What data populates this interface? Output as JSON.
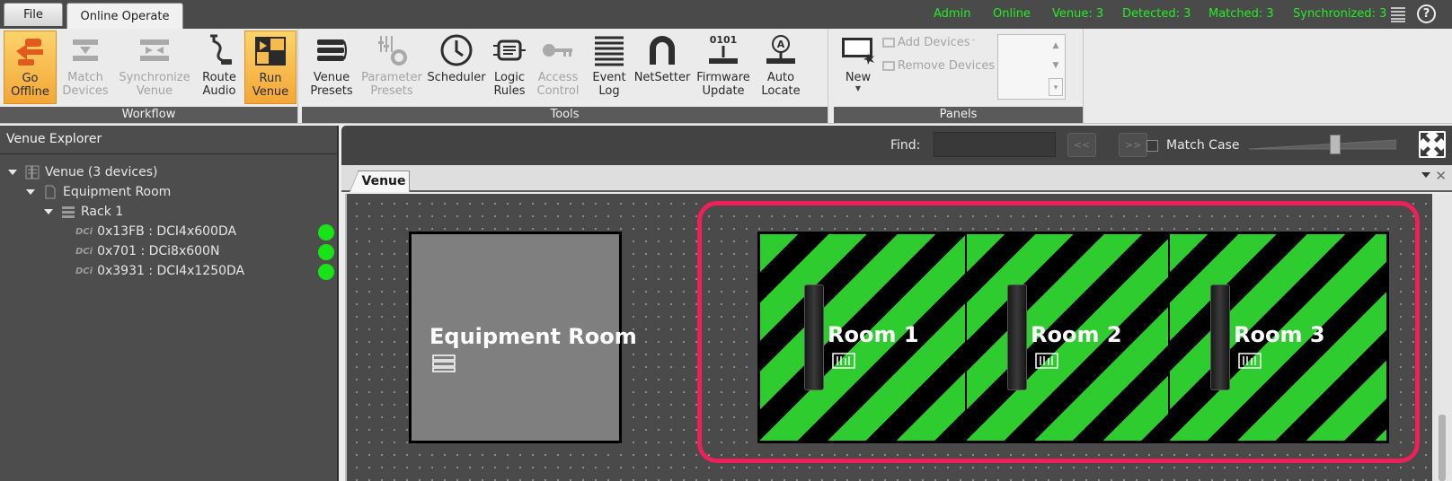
{
  "tabs": {
    "file": "File",
    "online_operate": "Online Operate"
  },
  "status": {
    "user": "Admin",
    "connection": "Online",
    "venue": "Venue: 3",
    "detected": "Detected: 3",
    "matched": "Matched: 3",
    "synchronized": "Synchronized: 3"
  },
  "ribbon": {
    "workflow": {
      "caption": "Workflow",
      "go_offline": "Go\nOffline",
      "match_devices": "Match\nDevices",
      "synchronize_venue": "Synchronize\nVenue",
      "route_audio": "Route\nAudio",
      "run_venue": "Run\nVenue"
    },
    "tools": {
      "caption": "Tools",
      "venue_presets": "Venue\nPresets",
      "parameter_presets": "Parameter\nPresets",
      "scheduler": "Scheduler",
      "logic_rules": "Logic\nRules",
      "access_control": "Access\nControl",
      "event_log": "Event\nLog",
      "netsetter": "NetSetter",
      "firmware_update": "Firmware\nUpdate",
      "auto_locate": "Auto\nLocate"
    },
    "panels": {
      "caption": "Panels",
      "new": "New",
      "add_devices": "Add Devices",
      "remove_devices": "Remove Devices"
    }
  },
  "explorer": {
    "title": "Venue Explorer",
    "venue": "Venue (3 devices)",
    "equipment_room": "Equipment Room",
    "rack": "Rack 1",
    "dci_tag": "DCi",
    "devices": [
      {
        "label": "0x13FB : DCI4x600DA",
        "status_color": "#17e317"
      },
      {
        "label": "0x701 : DCi8x600N",
        "status_color": "#17e317"
      },
      {
        "label": "0x3931 : DCI4x1250DA",
        "status_color": "#17e317"
      }
    ]
  },
  "find": {
    "label": "Find:",
    "value": "",
    "prev": "<<",
    "next": ">>",
    "match_case": "Match Case"
  },
  "document": {
    "tab": "Venue"
  },
  "canvas": {
    "equipment_room": "Equipment Room",
    "rooms": [
      "Room 1",
      "Room 2",
      "Room 3"
    ]
  },
  "colors": {
    "status_green": "#22ee22",
    "room_green": "#2fcc2f",
    "selection_red": "#ee1f5b",
    "run_highlight": "#f3a736"
  }
}
